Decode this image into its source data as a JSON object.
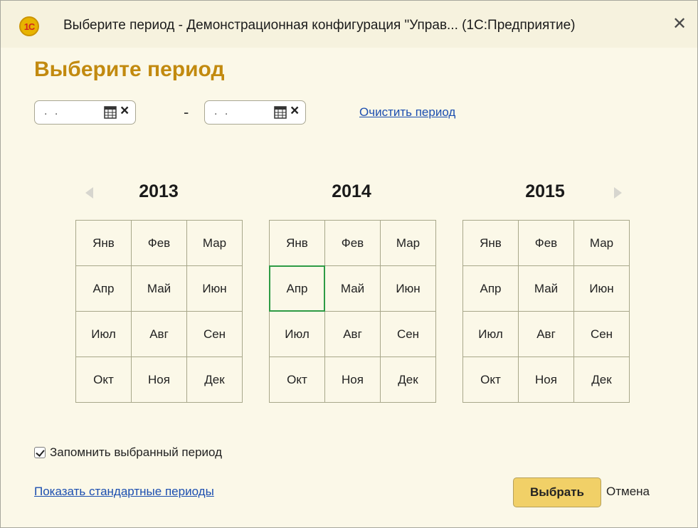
{
  "window": {
    "app_icon_text": "1С",
    "title": "Выберите период - Демонстрационная конфигурация \"Управ... (1С:Предприятие)",
    "close_symbol": "✕"
  },
  "heading": "Выберите период",
  "period": {
    "start": {
      "value": ". .",
      "calendar_icon": "calendar-icon",
      "clear_symbol": "×"
    },
    "separator": "-",
    "end": {
      "value": ". .",
      "calendar_icon": "calendar-icon",
      "clear_symbol": "×"
    },
    "clear_link": "Очистить период"
  },
  "calendar": {
    "prev_icon": "arrow-left-icon",
    "next_icon": "arrow-right-icon",
    "years": [
      {
        "year": "2013",
        "months": [
          "Янв",
          "Фев",
          "Мар",
          "Апр",
          "Май",
          "Июн",
          "Июл",
          "Авг",
          "Сен",
          "Окт",
          "Ноя",
          "Дек"
        ]
      },
      {
        "year": "2014",
        "months": [
          "Янв",
          "Фев",
          "Мар",
          "Апр",
          "Май",
          "Июн",
          "Июл",
          "Авг",
          "Сен",
          "Окт",
          "Ноя",
          "Дек"
        ]
      },
      {
        "year": "2015",
        "months": [
          "Янв",
          "Фев",
          "Мар",
          "Апр",
          "Май",
          "Июн",
          "Июл",
          "Авг",
          "Сен",
          "Окт",
          "Ноя",
          "Дек"
        ]
      }
    ],
    "current_month": {
      "year": "2014",
      "month": "Апр"
    },
    "highlight_color": "#2e9b45"
  },
  "remember": {
    "label": "Запомнить выбранный период",
    "checked": true
  },
  "footer": {
    "standard_periods_link": "Показать стандартные периоды",
    "ok_label": "Выбрать",
    "cancel_label": "Отмена"
  },
  "colors": {
    "background": "#fbf8e8",
    "heading": "#c28a0f",
    "link": "#1c4fb0",
    "default_button": "#f1d067"
  }
}
